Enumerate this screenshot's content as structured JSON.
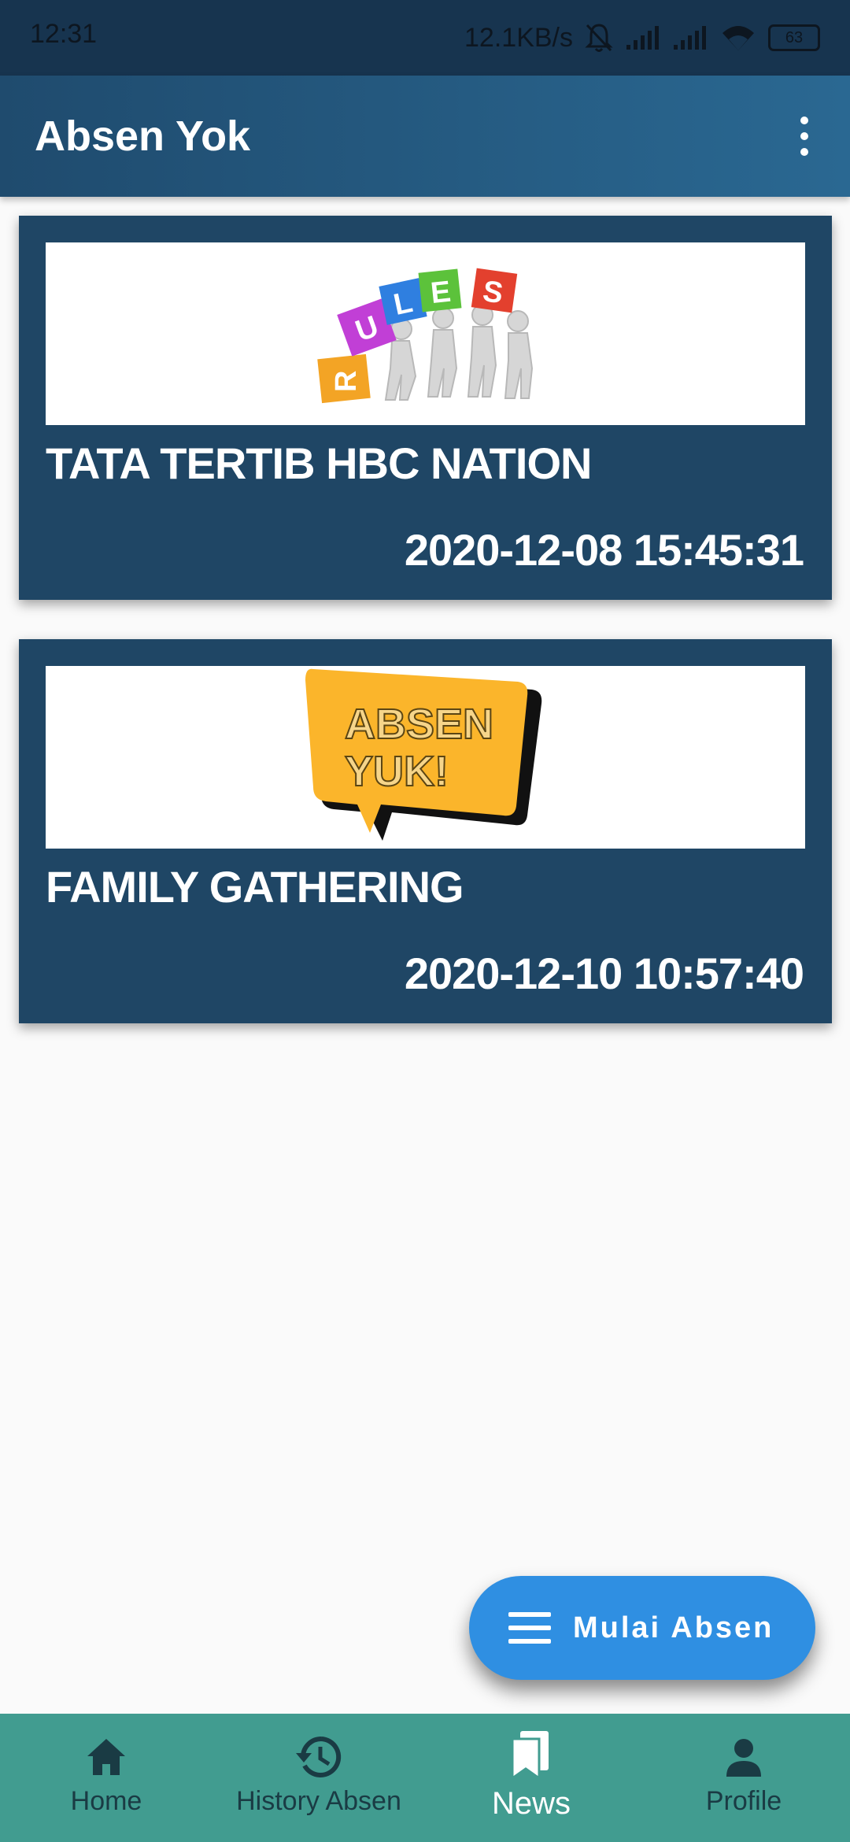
{
  "status_bar": {
    "time": "12:31",
    "net_speed": "12.1KB/s",
    "battery": "63"
  },
  "app_bar": {
    "title": "Absen Yok",
    "overflow_icon": "more-vert-icon"
  },
  "news": [
    {
      "title": "TATA TERTIB HBC NATION",
      "datetime": "2020-12-08 15:45:31",
      "image_letters": [
        "R",
        "U",
        "L",
        "E",
        "S"
      ]
    },
    {
      "title": "FAMILY GATHERING",
      "datetime": "2020-12-10 10:57:40",
      "image_text_line1": "ABSEN",
      "image_text_line2": "YUK!"
    }
  ],
  "fab": {
    "label": "Mulai Absen",
    "icon": "menu-icon"
  },
  "bottom_nav": [
    {
      "label": "Home",
      "icon": "home-icon"
    },
    {
      "label": "History Absen",
      "icon": "history-icon"
    },
    {
      "label": "News",
      "icon": "book-icon",
      "active": true
    },
    {
      "label": "Profile",
      "icon": "person-icon"
    }
  ],
  "colors": {
    "app_bar": "#1f4b6e",
    "card": "#1f4665",
    "fab": "#2f8fe2",
    "bottom_nav": "#419c90"
  }
}
